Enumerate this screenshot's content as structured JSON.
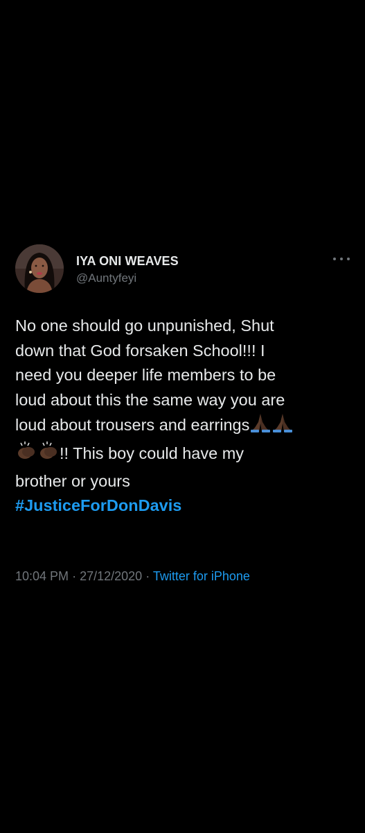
{
  "tweet": {
    "display_name": "IYA ONI WEAVES",
    "handle": "@Auntyfeyi",
    "more_icon": "more-options-icon",
    "lines": [
      "No one should go unpunished, Shut",
      "down that God forsaken School!!! I",
      "need you deeper life members to be",
      "loud about this the same way you are",
      "loud about trousers and earrings",
      "!! This boy could have my",
      "brother or yours"
    ],
    "emoji": [
      "folded-hands-icon",
      "folded-hands-icon",
      "clapping-hands-icon",
      "clapping-hands-icon"
    ],
    "hashtag": "#JusticeForDonDavis",
    "time": "10:04 PM",
    "separator": "·",
    "date": "27/12/2020",
    "source": "Twitter for iPhone"
  },
  "colors": {
    "background": "#000000",
    "text": "#e7e9ea",
    "muted": "#71767b",
    "accent": "#1d9bf0"
  }
}
